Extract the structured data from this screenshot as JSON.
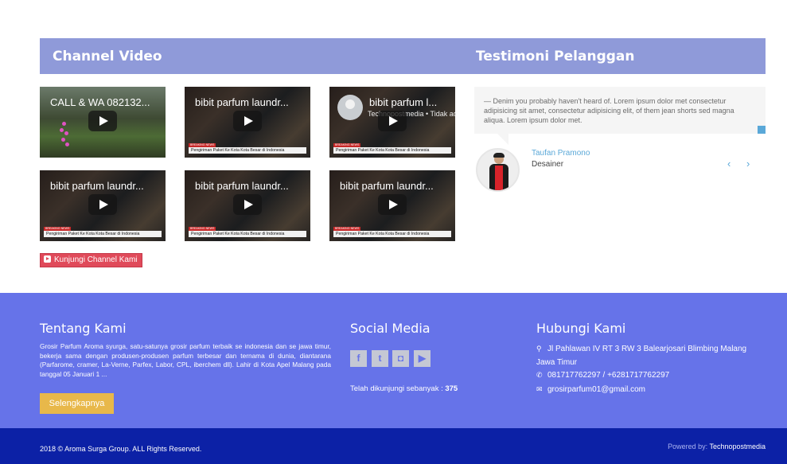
{
  "headers": {
    "channel_video": "Channel Video",
    "testimoni": "Testimoni Pelanggan"
  },
  "videos": [
    {
      "title": "CALL & WA 082132...",
      "caption": "",
      "tag": ""
    },
    {
      "title": "bibit parfum laundr...",
      "caption": "Pengiriman Paket Ke Kota Kota Besar di Indonesia",
      "tag": "BREAKING NEWS"
    },
    {
      "title": "bibit parfum l...",
      "sub": "Technopostmedia • Tidak ad",
      "caption": "Pengiriman Paket Ke Kota Kota Besar di Indonesia",
      "tag": "BREAKING NEWS"
    },
    {
      "title": "bibit parfum laundr...",
      "caption": "Pengiriman Paket Ke Kota Kota Besar di Indonesia",
      "tag": "BREAKING NEWS"
    },
    {
      "title": "bibit parfum laundr...",
      "caption": "Pengiriman Paket Ke Kota Kota Besar di Indonesia",
      "tag": "BREAKING NEWS"
    },
    {
      "title": "bibit parfum laundr...",
      "caption": "Pengiriman Paket Ke Kota Kota Besar di Indonesia",
      "tag": "BREAKING NEWS"
    }
  ],
  "channel_button": "Kunjungi Channel Kami",
  "testimonial": {
    "quote": "— Denim you probably haven't heard of. Lorem ipsum dolor met consectetur adipisicing sit amet, consectetur adipisicing elit, of them jean shorts sed magna aliqua. Lorem ipsum dolor met.",
    "name": "Taufan Pramono",
    "role": "Desainer",
    "prev": "‹",
    "next": "›"
  },
  "footer": {
    "about_title": "Tentang Kami",
    "about_text": "Grosir Parfum Aroma syurga, satu-satunya grosir parfum terbaik se indonesia dan se jawa timur, bekerja sama dengan produsen-produsen parfum terbesar dan ternama di dunia, diantarana (Parfarome, cramer, La-Verne, Parfex, Labor, CPL, iberchem dll). Lahir di Kota Apel Malang pada tanggal 05 Januari 1 ...",
    "more_button": "Selengkapnya",
    "social_title": "Social Media",
    "social_icons": [
      {
        "name": "facebook-icon",
        "glyph": "f"
      },
      {
        "name": "twitter-icon",
        "glyph": "t"
      },
      {
        "name": "instagram-icon",
        "glyph": "◘"
      },
      {
        "name": "youtube-icon",
        "glyph": "▶"
      }
    ],
    "visits_label": "Telah dikunjungi sebanyak :",
    "visits_count": "375",
    "contact_title": "Hubungi Kami",
    "address": "Jl Pahlawan IV RT 3 RW 3 Balearjosari Blimbing Malang Jawa Timur",
    "phone": "081717762297 / +6281717762297",
    "email": "grosirparfum01@gmail.com"
  },
  "bottom": {
    "copyright": "2018 © Aroma Surga Group. ALL Rights Reserved.",
    "powered_label": "Powered by:",
    "powered_by": "Technopostmedia"
  },
  "colors": {
    "header_band": "#8f9ad9",
    "footer": "#6673e9",
    "bottom_bar": "#0c21a6",
    "accent_blue": "#5aa8d8",
    "button_yellow": "#e8b84a",
    "youtube_red": "#e04a5a"
  }
}
